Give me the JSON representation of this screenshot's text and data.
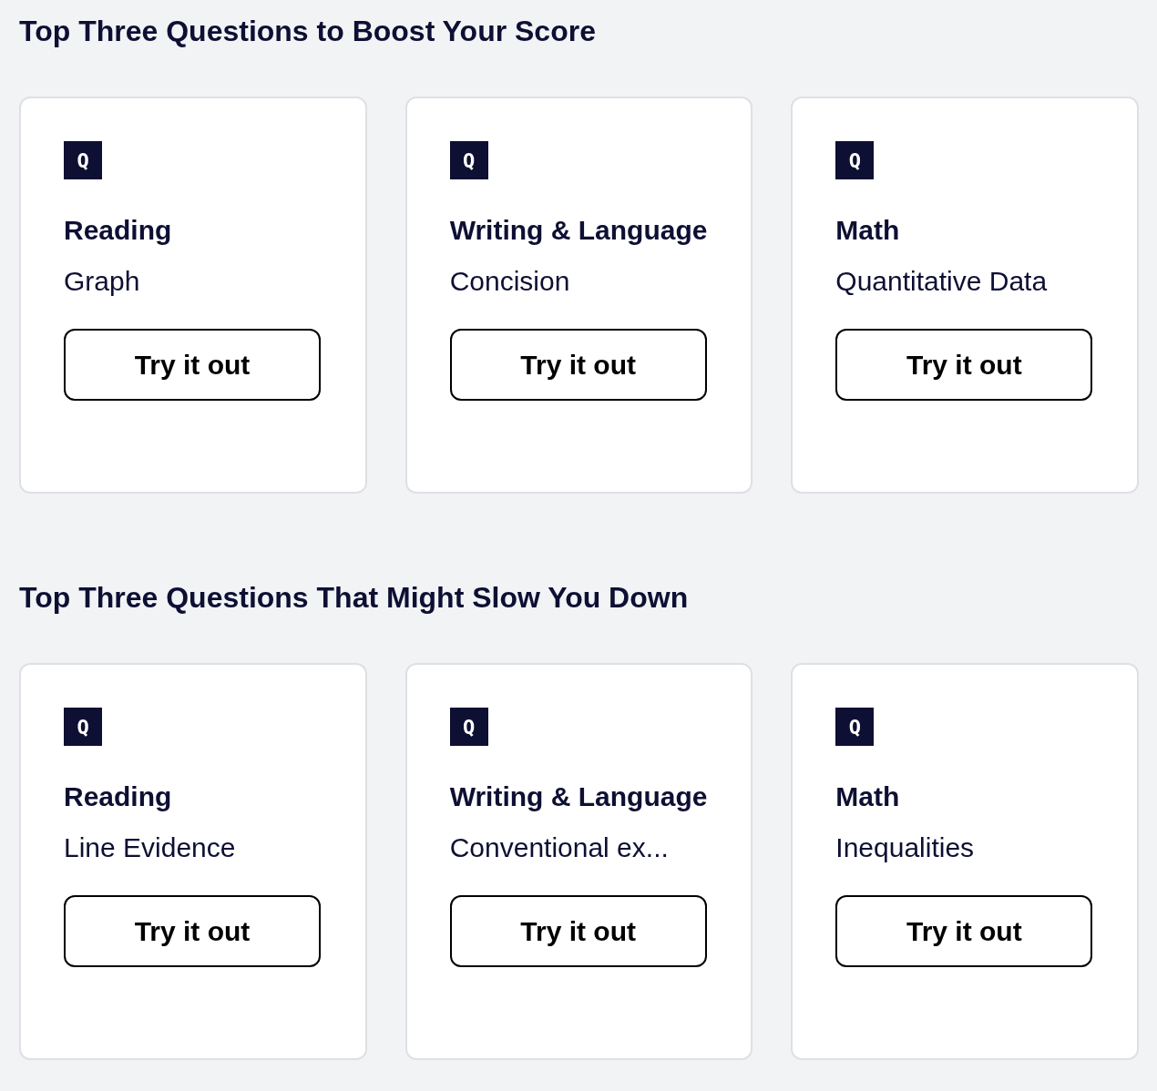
{
  "sections": [
    {
      "title": "Top Three Questions to Boost Your Score",
      "cards": [
        {
          "badge": "Q",
          "subject": "Reading",
          "topic": "Graph",
          "button": "Try it out"
        },
        {
          "badge": "Q",
          "subject": "Writing & Language",
          "topic": "Concision",
          "button": "Try it out"
        },
        {
          "badge": "Q",
          "subject": "Math",
          "topic": "Quantitative Data",
          "button": "Try it out"
        }
      ]
    },
    {
      "title": "Top Three Questions That Might Slow You Down",
      "cards": [
        {
          "badge": "Q",
          "subject": "Reading",
          "topic": "Line Evidence",
          "button": "Try it out"
        },
        {
          "badge": "Q",
          "subject": "Writing & Language",
          "topic": "Conventional ex...",
          "button": "Try it out"
        },
        {
          "badge": "Q",
          "subject": "Math",
          "topic": "Inequalities",
          "button": "Try it out"
        }
      ]
    }
  ]
}
